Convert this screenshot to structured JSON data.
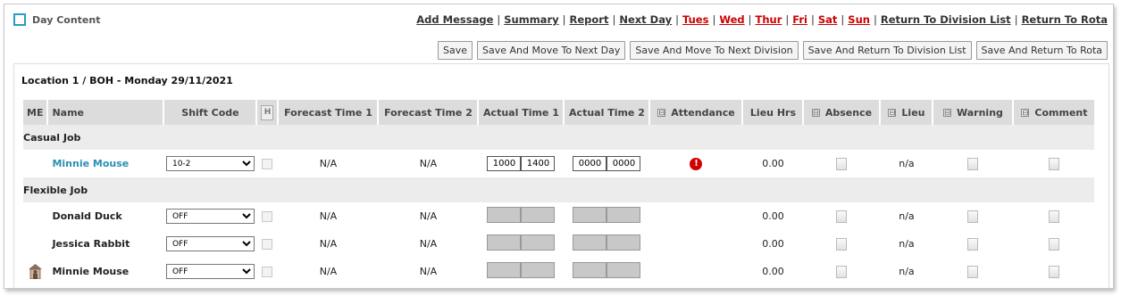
{
  "header": {
    "title": "Day Content"
  },
  "nav": {
    "add_message": "Add Message",
    "summary": "Summary",
    "report": "Report",
    "next_day": "Next Day",
    "tues": "Tues",
    "wed": "Wed",
    "thur": "Thur",
    "fri": "Fri",
    "sat": "Sat",
    "sun": "Sun",
    "return_division": "Return To Division List",
    "return_rota": "Return To Rota",
    "separator": "|"
  },
  "actions": {
    "save": "Save",
    "save_next_day": "Save And Move To Next Day",
    "save_next_division": "Save And Move To Next Division",
    "save_return_division": "Save And Return To Division List",
    "save_return_rota": "Save And Return To Rota"
  },
  "location": "Location 1 / BOH - Monday 29/11/2021",
  "columns": {
    "me": "ME",
    "name": "Name",
    "shift_code": "Shift Code",
    "h": "H",
    "forecast1": "Forecast Time 1",
    "forecast2": "Forecast Time 2",
    "actual1": "Actual Time 1",
    "actual2": "Actual Time 2",
    "attendance": "Attendance",
    "lieu_hrs": "Lieu Hrs",
    "absence": "Absence",
    "lieu": "Lieu",
    "warning": "Warning",
    "comment": "Comment",
    "collapse_symbol": "⊟"
  },
  "groups": {
    "casual": "Casual Job",
    "flexible": "Flexible Job"
  },
  "rows": [
    {
      "name": "Minnie Mouse",
      "shift": "10-2",
      "forecast1": "N/A",
      "forecast2": "N/A",
      "a1_start": "1000",
      "a1_end": "1400",
      "a2_start": "0000",
      "a2_end": "0000",
      "attendance": "!",
      "lieu_hrs": "0.00",
      "lieu": "n/a"
    },
    {
      "name": "Donald Duck",
      "shift": "OFF",
      "forecast1": "N/A",
      "forecast2": "N/A",
      "lieu_hrs": "0.00",
      "lieu": "n/a"
    },
    {
      "name": "Jessica Rabbit",
      "shift": "OFF",
      "forecast1": "N/A",
      "forecast2": "N/A",
      "lieu_hrs": "0.00",
      "lieu": "n/a"
    },
    {
      "name": "Minnie Mouse",
      "shift": "OFF",
      "forecast1": "N/A",
      "forecast2": "N/A",
      "lieu_hrs": "0.00",
      "lieu": "n/a"
    }
  ],
  "colors": {
    "accent": "#2b9bc2",
    "day_link": "#cc0000",
    "alert": "#d30000",
    "header_bg": "#dcdcdc",
    "group_bg": "#ececec"
  }
}
